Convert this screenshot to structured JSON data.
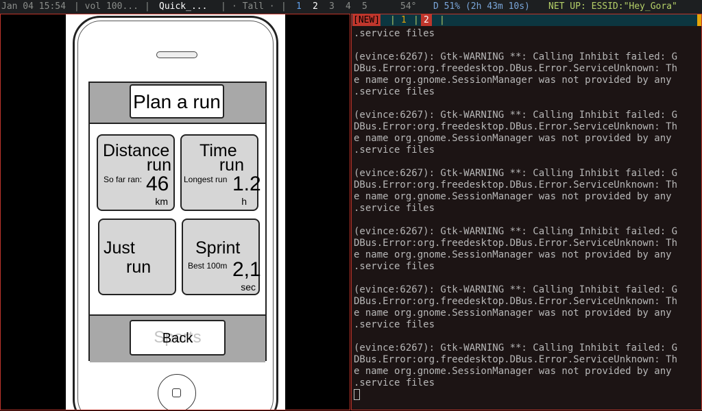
{
  "statusbar": {
    "datetime": "Jan 04 15:54",
    "volume": "| vol 100...",
    "sep1": "|",
    "window_title": "Quick_...",
    "sep2": "|",
    "layout": "· Tall ·",
    "sep3": "|",
    "workspaces": [
      "1",
      "2",
      "3",
      "4",
      "5"
    ],
    "temperature": "54°",
    "battery": "D 51% (2h 43m 10s)",
    "network": "NET UP: ESSID:\"Hey_Gora\""
  },
  "phone": {
    "header_button": "Plan a run",
    "tiles": {
      "distance": {
        "title1": "Distance",
        "title2": "run",
        "small": "So far ran:",
        "value": "46",
        "unit": "km"
      },
      "time": {
        "title1": "Time",
        "title2": "run",
        "small": "Longest run",
        "value": "1.2",
        "unit": "h"
      },
      "just": {
        "title1": "Just",
        "title2": "run"
      },
      "sprint": {
        "title1": "Sprint",
        "small": "Best 100m",
        "value": "2,1",
        "unit": "sec"
      }
    },
    "back_ghost": "Sports",
    "back_label": "Back"
  },
  "tmux": {
    "new_label": "[NEW]",
    "windows": [
      "1",
      "2"
    ]
  },
  "terminal": {
    "lines": [
      ".service files",
      "",
      "(evince:6267): Gtk-WARNING **: Calling Inhibit failed: G",
      "DBus.Error:org.freedesktop.DBus.Error.ServiceUnknown: Th",
      "e name org.gnome.SessionManager was not provided by any",
      ".service files",
      "",
      "(evince:6267): Gtk-WARNING **: Calling Inhibit failed: G",
      "DBus.Error:org.freedesktop.DBus.Error.ServiceUnknown: Th",
      "e name org.gnome.SessionManager was not provided by any",
      ".service files",
      "",
      "(evince:6267): Gtk-WARNING **: Calling Inhibit failed: G",
      "DBus.Error:org.freedesktop.DBus.Error.ServiceUnknown: Th",
      "e name org.gnome.SessionManager was not provided by any",
      ".service files",
      "",
      "(evince:6267): Gtk-WARNING **: Calling Inhibit failed: G",
      "DBus.Error:org.freedesktop.DBus.Error.ServiceUnknown: Th",
      "e name org.gnome.SessionManager was not provided by any",
      ".service files",
      "",
      "(evince:6267): Gtk-WARNING **: Calling Inhibit failed: G",
      "DBus.Error:org.freedesktop.DBus.Error.ServiceUnknown: Th",
      "e name org.gnome.SessionManager was not provided by any",
      ".service files",
      "",
      "(evince:6267): Gtk-WARNING **: Calling Inhibit failed: G",
      "DBus.Error:org.freedesktop.DBus.Error.ServiceUnknown: Th",
      "e name org.gnome.SessionManager was not provided by any",
      ".service files"
    ]
  },
  "colors": {
    "accent_red": "#c0362c",
    "terminal_bg": "#1c1414",
    "tmux_bar_bg": "#0c3640"
  }
}
